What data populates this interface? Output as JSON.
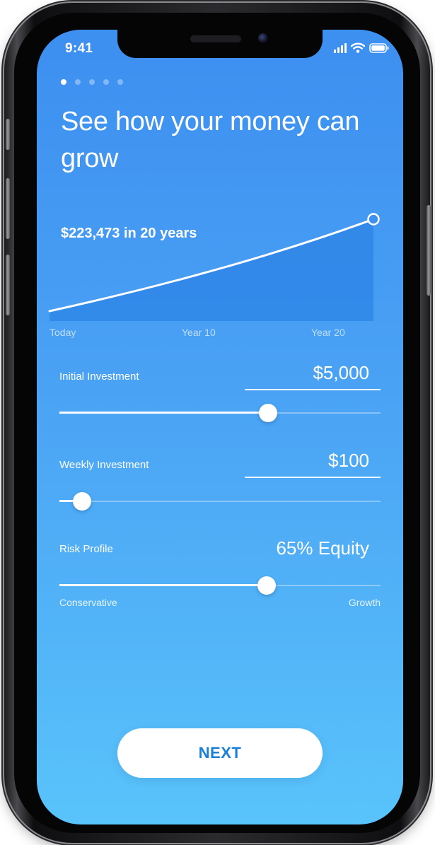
{
  "status_bar": {
    "time": "9:41",
    "icons": [
      "signal-icon",
      "wifi-icon",
      "battery-icon"
    ]
  },
  "pager": {
    "count": 5,
    "active_index": 0
  },
  "title": "See how your money can grow",
  "chart": {
    "projection_text": "$223,473 in 20 years",
    "axis_labels": [
      "Today",
      "Year 10",
      "Year 20"
    ]
  },
  "chart_data": {
    "type": "area",
    "x": [
      "Today",
      "Year 10",
      "Year 20"
    ],
    "series": [
      {
        "values": [
          5000,
          95000,
          223473
        ]
      }
    ],
    "annotations": [
      "$223,473 in 20 years"
    ]
  },
  "initial_investment": {
    "label": "Initial Investment",
    "value": "$5,000",
    "slider_fraction": 0.65
  },
  "weekly_investment": {
    "label": "Weekly Investment",
    "value": "$100",
    "slider_fraction": 0.07
  },
  "risk_profile": {
    "label": "Risk Profile",
    "value": "65% Equity",
    "slider_fraction": 0.645,
    "min_label": "Conservative",
    "max_label": "Growth"
  },
  "next_button": {
    "label": "NEXT"
  },
  "colors": {
    "background_top": "#3d8ff0",
    "background_bottom": "#59c3fb",
    "chart_fill": "#2f86e6",
    "button_text": "#1b80d8"
  }
}
